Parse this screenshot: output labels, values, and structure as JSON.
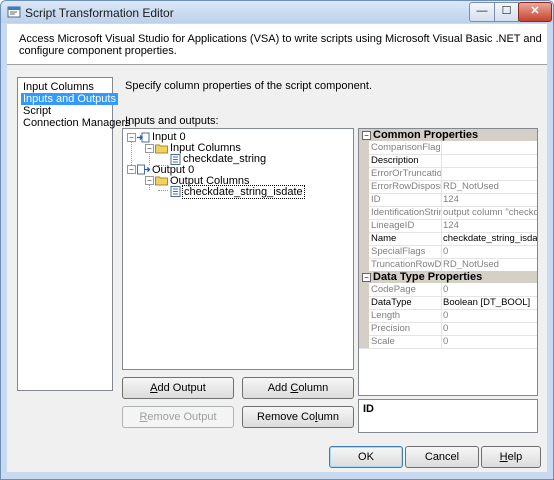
{
  "window": {
    "title": "Script Transformation Editor",
    "minimize_glyph": "—",
    "maximize_glyph": "☐",
    "close_glyph": "✕"
  },
  "header": {
    "text": "Access Microsoft Visual Studio for Applications (VSA) to write scripts using Microsoft Visual Basic .NET and configure component properties."
  },
  "nav": {
    "items": [
      {
        "label": "Input Columns"
      },
      {
        "label": "Inputs and Outputs",
        "selected": true
      },
      {
        "label": "Script"
      },
      {
        "label": "Connection Managers"
      }
    ]
  },
  "page": {
    "description": "Specify column properties of the script component.",
    "io_label_prefix": "I",
    "io_label_rest": "nputs and outputs:"
  },
  "tree": {
    "input0": "Input 0",
    "input_columns": "Input Columns",
    "input_col1": "checkdate_string",
    "output0": "Output 0",
    "output_columns": "Output Columns",
    "output_col1": "checkdate_string_isdate",
    "expander_minus": "−"
  },
  "buttons": {
    "add_output_u": "A",
    "add_output_rest": "dd Output",
    "add_column_pre": "Add ",
    "add_column_u": "C",
    "add_column_rest": "olumn",
    "remove_output_u": "R",
    "remove_output_rest": "emove Output",
    "remove_column_pre": "Remove Co",
    "remove_column_u": "l",
    "remove_column_rest": "umn",
    "ok": "OK",
    "cancel": "Cancel",
    "help_u": "H",
    "help_rest": "elp"
  },
  "properties": {
    "common_title": "Common Properties",
    "common": [
      {
        "name": "ComparisonFlags",
        "value": "",
        "editable": false
      },
      {
        "name": "Description",
        "value": "",
        "editable": true
      },
      {
        "name": "ErrorOrTruncationO",
        "value": "",
        "editable": false
      },
      {
        "name": "ErrorRowDisposition",
        "value": "RD_NotUsed",
        "editable": false
      },
      {
        "name": "ID",
        "value": "124",
        "editable": false
      },
      {
        "name": "IdentificationString",
        "value": "output column \"checkdat",
        "editable": false
      },
      {
        "name": "LineageID",
        "value": "124",
        "editable": false
      },
      {
        "name": "Name",
        "value": "checkdate_string_isdate",
        "editable": true
      },
      {
        "name": "SpecialFlags",
        "value": "0",
        "editable": false
      },
      {
        "name": "TruncationRowDisp",
        "value": "RD_NotUsed",
        "editable": false
      }
    ],
    "datatype_title": "Data Type Properties",
    "datatype": [
      {
        "name": "CodePage",
        "value": "0",
        "editable": false
      },
      {
        "name": "DataType",
        "value": "Boolean [DT_BOOL]",
        "editable": true
      },
      {
        "name": "Length",
        "value": "0",
        "editable": false
      },
      {
        "name": "Precision",
        "value": "0",
        "editable": false
      },
      {
        "name": "Scale",
        "value": "0",
        "editable": false
      }
    ],
    "help_title": "ID"
  },
  "colors": {
    "selection": "#3399ff",
    "title_bg": "#c9daf0",
    "close_red": "#c8432d",
    "category_gray": "#d4d0c8"
  }
}
